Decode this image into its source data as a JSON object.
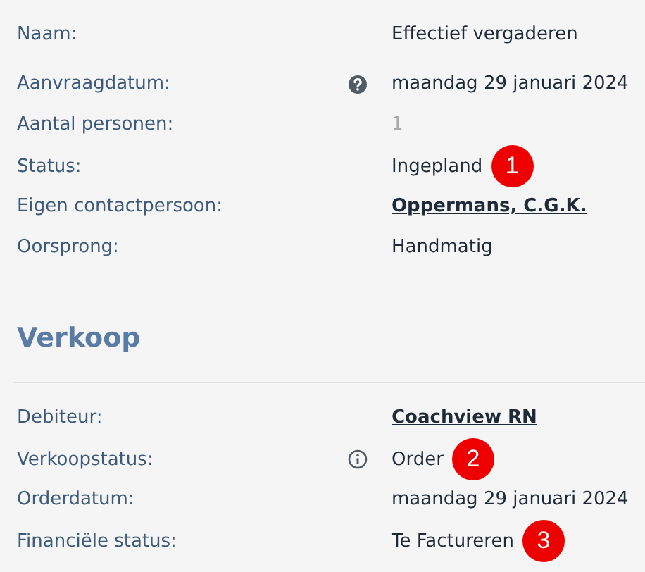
{
  "sections": [
    {
      "rows": [
        {
          "label": "Naam:",
          "kind": "plain",
          "value": "Effectief vergaderen",
          "link": false,
          "disabled": false
        },
        {
          "label": "Aanvraagdatum:",
          "kind": "help",
          "value": "maandag 29 januari 2024",
          "link": false,
          "disabled": false
        },
        {
          "label": "Aantal personen:",
          "kind": "plain",
          "value": "1",
          "link": false,
          "disabled": true
        },
        {
          "label": "Status:",
          "kind": "plain",
          "value": "Ingepland",
          "link": false,
          "disabled": false,
          "badge": "1"
        },
        {
          "label": "Eigen contactpersoon:",
          "kind": "plain",
          "value": "Oppermans, C.G.K.",
          "link": true,
          "disabled": false
        },
        {
          "label": "Oorsprong:",
          "kind": "plain",
          "value": "Handmatig",
          "link": false,
          "disabled": false
        }
      ]
    },
    {
      "heading": "Verkoop",
      "rows": [
        {
          "label": "Debiteur:",
          "kind": "plain",
          "value": "Coachview RN",
          "link": true,
          "disabled": false
        },
        {
          "label": "Verkoopstatus:",
          "kind": "info",
          "value": "Order",
          "link": false,
          "disabled": false,
          "badge": "2"
        },
        {
          "label": "Orderdatum:",
          "kind": "plain",
          "value": "maandag 29 januari 2024",
          "link": false,
          "disabled": false
        },
        {
          "label": "Financiële status:",
          "kind": "plain",
          "value": "Te Factureren",
          "link": false,
          "disabled": false,
          "badge": "3"
        }
      ]
    }
  ]
}
